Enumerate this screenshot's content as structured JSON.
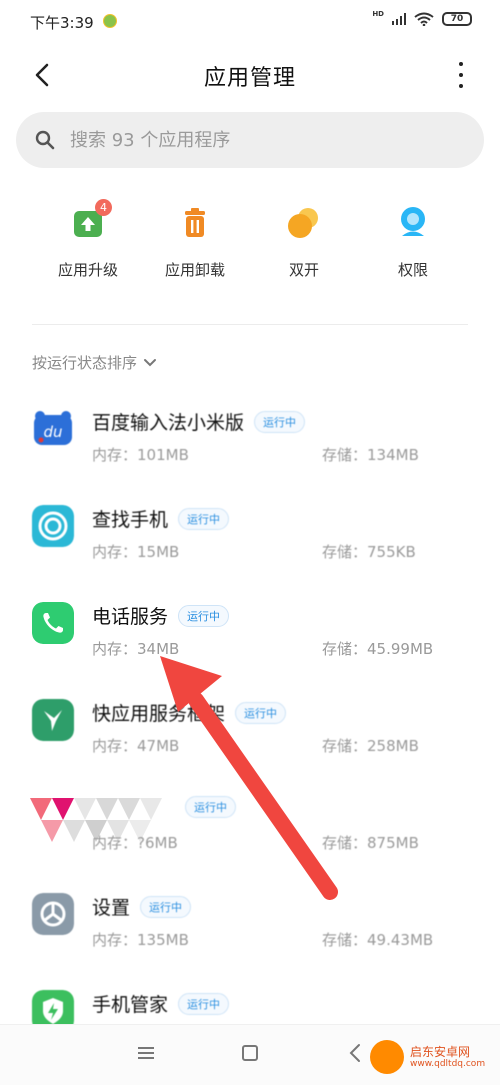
{
  "status_bar": {
    "time": "下午3:39",
    "hd": "HD",
    "battery": "70"
  },
  "header": {
    "title": "应用管理"
  },
  "search": {
    "placeholder": "搜索 93 个应用程序"
  },
  "quick_actions": [
    {
      "label": "应用升级",
      "badge": "4",
      "icon": "upgrade-icon",
      "color": "#4caf50"
    },
    {
      "label": "应用卸载",
      "icon": "trash-icon",
      "color": "#f08a24"
    },
    {
      "label": "双开",
      "icon": "dual-app-icon",
      "color": "#f5b82e"
    },
    {
      "label": "权限",
      "icon": "permission-icon",
      "color": "#29b6f6"
    }
  ],
  "sort_label": "按运行状态排序",
  "status_tag": "运行中",
  "apps": [
    {
      "name": "百度输入法小米版",
      "memory": "内存：101MB",
      "storage": "存储：134MB",
      "icon": "baidu-ime-icon"
    },
    {
      "name": "查找手机",
      "memory": "内存：15MB",
      "storage": "存储：755KB",
      "icon": "find-phone-icon"
    },
    {
      "name": "电话服务",
      "memory": "内存：34MB",
      "storage": "存储：45.99MB",
      "icon": "phone-service-icon"
    },
    {
      "name": "快应用服务框架",
      "memory": "内存：47MB",
      "storage": "存储：258MB",
      "icon": "quick-app-icon"
    },
    {
      "name": "",
      "memory": "内存：?6MB",
      "storage": "存储：875MB",
      "icon": "blurred-app-icon"
    },
    {
      "name": "设置",
      "memory": "内存：135MB",
      "storage": "存储：49.43MB",
      "icon": "settings-icon"
    },
    {
      "name": "手机管家",
      "icon": "security-app-icon"
    }
  ],
  "watermark": {
    "text": "启东安卓网",
    "url": "www.qdltdq.com"
  },
  "colors": {
    "accent_blue": "#2a8fe0",
    "arrow_red": "#f0463f"
  }
}
